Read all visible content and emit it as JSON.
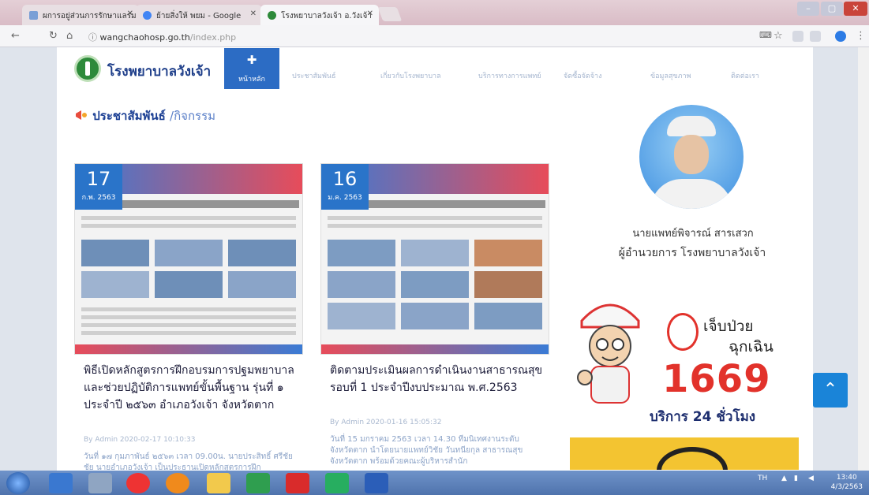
{
  "browser": {
    "tabs": [
      {
        "label": "ผการอยู่ส่วนการรักษาแลรม",
        "icon_color": "#7a9fd6"
      },
      {
        "label": "ย้ายสิ่งให้ พยม - Google",
        "icon_color": "#4285f4"
      },
      {
        "label": "โรงพยาบาลวังเจ้า อ.วังเจ้า",
        "icon_color": "#2d8a3a",
        "active": true
      }
    ],
    "url_host": "wangchaohosp.go.th",
    "url_path": "/index.php"
  },
  "header": {
    "site_name": "โรงพยาบาลวังเจ้า",
    "home_label": "หน้าหลัก",
    "nav": [
      "ประชาสัมพันธ์",
      "เกี่ยวกับโรงพยาบาล",
      "บริการทางการแพทย์",
      "จัดซื้อจัดจ้าง",
      "ข้อมูลสุขภาพ",
      "ติดต่อเรา"
    ]
  },
  "section": {
    "title": "ประชาสัมพันธ์",
    "subtitle": "/กิจกรรม"
  },
  "posts": [
    {
      "day": "17",
      "month": "ก.พ. 2563",
      "title": "พิธีเปิดหลักสูตรการฝึกอบรมการปฐมพยาบาลและช่วยปฏิบัติการแพทย์ขั้นพื้นฐาน รุ่นที่ ๑ ประจำปี ๒๕๖๓ อำเภอวังเจ้า จังหวัดตาก",
      "meta": "By Admin 2020-02-17 10:10:33",
      "excerpt": "วันที่ ๑๗ กุมภาพันธ์ ๒๕๖๓ เวลา 09.00น. นายประสิทธิ์ ศรีชัยชัย นายอำเภอวังเจ้า เป็นประธานเปิดหลักสูตรการฝึก"
    },
    {
      "day": "16",
      "month": "ม.ค. 2563",
      "title": "ติดตามประเมินผลการดำเนินงานสาธารณสุข รอบที่ 1 ประจำปีงบประมาณ พ.ศ.2563",
      "meta": "By Admin 2020-01-16 15:05:32",
      "excerpt": "วันที่ 15 มกราคม 2563 เวลา 14.30 ทีมนิเทศงานระดับจังหวัดตาก นำโดยนายแพทย์วิชัย วันทนียกุล สาธารณสุขจังหวัดตาก พร้อมด้วยคณะผู้บริหารสำนัก"
    }
  ],
  "director": {
    "name": "นายแพทย์พิจารณ์ สารเสวก",
    "title": "ผู้อำนวยการ โรงพยาบาลวังเจ้า"
  },
  "emergency": {
    "line1": "เจ็บป่วย",
    "line2": "ฉุกเฉิน",
    "number": "1669",
    "service": "บริการ 24 ชั่วโมง"
  },
  "taskbar": {
    "lang": "TH",
    "time": "13:40",
    "date": "4/3/2563"
  },
  "colors": {
    "brand_blue": "#2c6cc4",
    "emergency_red": "#e2322b"
  }
}
